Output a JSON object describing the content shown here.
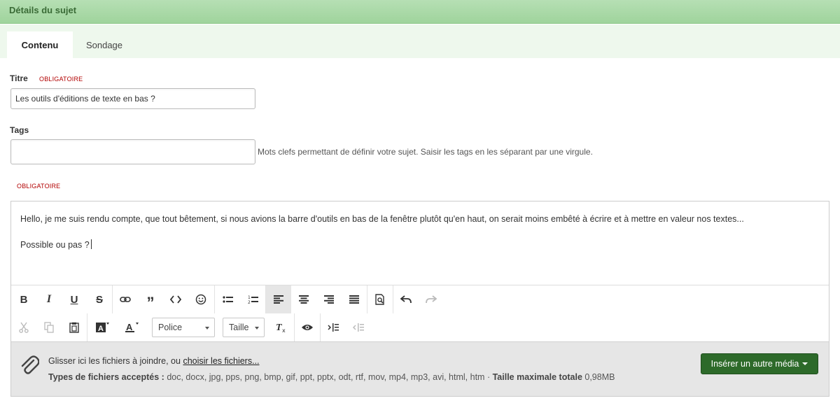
{
  "header": {
    "title": "Détails du sujet"
  },
  "tabs": [
    {
      "label": "Contenu",
      "active": true
    },
    {
      "label": "Sondage",
      "active": false
    }
  ],
  "form": {
    "title_label": "Titre",
    "title_required": "OBLIGATOIRE",
    "title_value": "Les outils d'éditions de texte en bas ?",
    "tags_label": "Tags",
    "tags_value": "",
    "tags_help": "Mots clefs permettant de définir votre sujet. Saisir les tags en les séparant par une virgule.",
    "message_required": "OBLIGATOIRE"
  },
  "editor": {
    "paragraphs": [
      "Hello, je me suis rendu compte, que tout bêtement, si nous avions la barre d'outils en bas de la fenêtre plutôt qu'en haut, on serait moins embêté à écrire et à mettre en valeur nos textes...",
      "Possible ou pas ?"
    ],
    "toolbar_row1": [
      "bold-icon",
      "italic-icon",
      "underline-icon",
      "strikethrough-icon",
      "link-icon",
      "quote-icon",
      "code-icon",
      "emoji-icon",
      "bullet-list-icon",
      "numbered-list-icon",
      "align-left-icon",
      "align-center-icon",
      "align-right-icon",
      "align-justify-icon",
      "preview-icon",
      "undo-icon",
      "redo-icon"
    ],
    "toolbar_row2": [
      "cut-icon",
      "copy-icon",
      "paste-icon",
      "background-color-icon",
      "text-color-icon",
      "clear-format-icon",
      "eye-icon",
      "indent-icon",
      "outdent-icon"
    ],
    "font_select": "Police",
    "size_select": "Taille"
  },
  "attachments": {
    "drop_text": "Glisser ici les fichiers à joindre, ou",
    "choose_link": "choisir les fichiers...",
    "types_label": "Types de fichiers acceptés :",
    "types_value": "doc, docx, jpg, pps, png, bmp, gif, ppt, pptx, odt, rtf, mov, mp4, mp3, avi, html, htm",
    "separator": "·",
    "max_size_label": "Taille maximale totale",
    "max_size_value": "0,98MB",
    "insert_media_button": "Insérer un autre média"
  },
  "colors": {
    "header_green": "#9fd49c",
    "tab_bar": "#eef8ed",
    "required_red": "#b20000",
    "media_button": "#2d6a2a",
    "attach_bg": "#e6e6e6"
  }
}
